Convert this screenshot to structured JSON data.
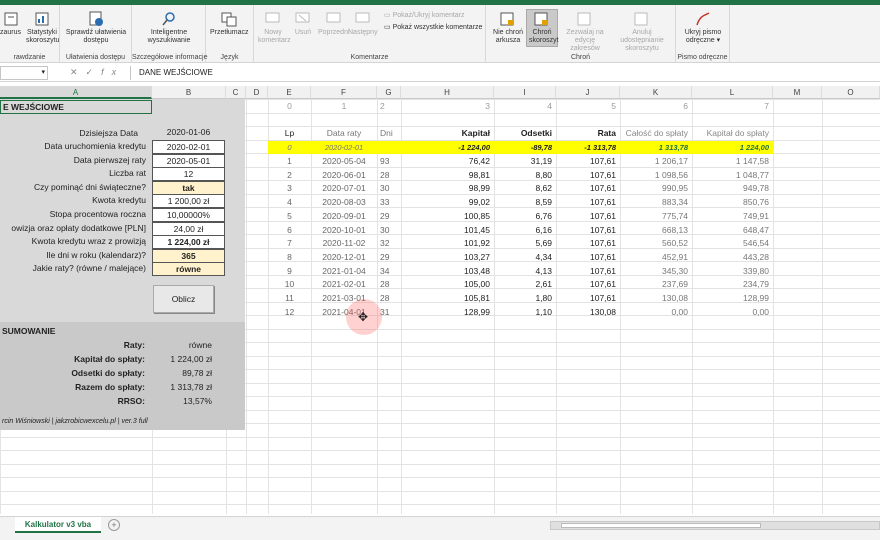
{
  "ribbon": {
    "groups": [
      {
        "label": "rawdzanie",
        "buttons": [
          "zaurus",
          "Statystyki skoroszytu"
        ]
      },
      {
        "label": "Ułatwienia dostępu",
        "buttons": [
          "Sprawdź ułatwienia dostępu"
        ]
      },
      {
        "label": "Szczegółowe informacje",
        "buttons": [
          "Inteligentne wyszukiwanie"
        ]
      },
      {
        "label": "Język",
        "buttons": [
          "Przetłumacz"
        ]
      },
      {
        "label": "Komentarze",
        "buttons": [
          "Nowy komentarz",
          "Usuń",
          "Poprzedni",
          "Następny"
        ],
        "small": [
          "Pokaż/Ukryj komentarz",
          "Pokaż wszystkie komentarze"
        ]
      },
      {
        "label": "Chroń",
        "buttons": [
          "Nie chroń arkusza",
          "Chroń skoroszyt",
          "Zezwalaj na edycję zakresów",
          "Anuluj udostępnianie skoroszytu"
        ]
      },
      {
        "label": "Pismo odręczne",
        "buttons": [
          "Ukryj pismo odręczne"
        ]
      }
    ]
  },
  "formula_bar": {
    "namebox": "",
    "content": "DANE WEJŚCIOWE",
    "icons": [
      "✕",
      "✓",
      "fx"
    ]
  },
  "columns": [
    "A",
    "B",
    "C",
    "D",
    "E",
    "F",
    "G",
    "H",
    "I",
    "J",
    "K",
    "L",
    "M",
    "O"
  ],
  "inputs": {
    "title": "E WEJŚCIOWE",
    "today_label": "Dzisiejsza Data",
    "today_value": "2020-01-06",
    "fields": [
      {
        "label": "Data uruchomienia kredytu",
        "value": "2020-02-01",
        "style": "white"
      },
      {
        "label": "Data pierwszej raty",
        "value": "2020-05-01",
        "style": "white"
      },
      {
        "label": "Liczba rat",
        "value": "12",
        "style": "white"
      },
      {
        "label": "Czy pominąć dni świąteczne?",
        "value": "tak",
        "style": "yellow"
      },
      {
        "label": "Kwota kredytu",
        "value": "1 200,00 zł",
        "style": "white"
      },
      {
        "label": "Stopa procentowa roczna",
        "value": "10,00000%",
        "style": "white"
      },
      {
        "label": "owizja oraz opłaty dodatkowe [PLN]",
        "value": "24,00 zł",
        "style": "white"
      },
      {
        "label": "Kwota kredytu wraz z prowizją",
        "value": "1 224,00 zł",
        "style": "bold"
      },
      {
        "label": "Ile dni w roku (kalendarz)?",
        "value": "365",
        "style": "yellow"
      },
      {
        "label": "Jakie raty? (równe / malejące)",
        "value": "równe",
        "style": "yellow"
      }
    ],
    "button": "Oblicz"
  },
  "summary": {
    "title": "SUMOWANIE",
    "rows": [
      {
        "label": "Raty:",
        "value": "równe"
      },
      {
        "label": "Kapitał do spłaty:",
        "value": "1 224,00 zł"
      },
      {
        "label": "Odsetki do spłaty:",
        "value": "89,78 zł"
      },
      {
        "label": "Razem do spłaty:",
        "value": "1 313,78 zł"
      },
      {
        "label": "RRSO:",
        "value": "13,57%"
      }
    ],
    "credit": "rcin Wiśniowski | jakzrobicwexcelu.pl | ver.3 full"
  },
  "table": {
    "index_row": [
      "0",
      "1",
      "2",
      "3",
      "4",
      "5",
      "6",
      "7"
    ],
    "headers": [
      "Lp",
      "Data raty",
      "Dni",
      "Kapitał",
      "Odsetki",
      "Rata",
      "Całość do spłaty",
      "Kapitał do spłaty"
    ],
    "initial_row": [
      "0",
      "2020-02-01",
      "",
      "-1 224,00",
      "-89,78",
      "-1 313,78",
      "1 313,78",
      "1 224,00"
    ],
    "rows": [
      [
        "1",
        "2020-05-04",
        "93",
        "76,42",
        "31,19",
        "107,61",
        "1 206,17",
        "1 147,58"
      ],
      [
        "2",
        "2020-06-01",
        "28",
        "98,81",
        "8,80",
        "107,61",
        "1 098,56",
        "1 048,77"
      ],
      [
        "3",
        "2020-07-01",
        "30",
        "98,99",
        "8,62",
        "107,61",
        "990,95",
        "949,78"
      ],
      [
        "4",
        "2020-08-03",
        "33",
        "99,02",
        "8,59",
        "107,61",
        "883,34",
        "850,76"
      ],
      [
        "5",
        "2020-09-01",
        "29",
        "100,85",
        "6,76",
        "107,61",
        "775,74",
        "749,91"
      ],
      [
        "6",
        "2020-10-01",
        "30",
        "101,45",
        "6,16",
        "107,61",
        "668,13",
        "648,47"
      ],
      [
        "7",
        "2020-11-02",
        "32",
        "101,92",
        "5,69",
        "107,61",
        "560,52",
        "546,54"
      ],
      [
        "8",
        "2020-12-01",
        "29",
        "103,27",
        "4,34",
        "107,61",
        "452,91",
        "443,28"
      ],
      [
        "9",
        "2021-01-04",
        "34",
        "103,48",
        "4,13",
        "107,61",
        "345,30",
        "339,80"
      ],
      [
        "10",
        "2021-02-01",
        "28",
        "105,00",
        "2,61",
        "107,61",
        "237,69",
        "234,79"
      ],
      [
        "11",
        "2021-03-01",
        "28",
        "105,81",
        "1,80",
        "107,61",
        "130,08",
        "128,99"
      ],
      [
        "12",
        "2021-04-01",
        "31",
        "128,99",
        "1,10",
        "130,08",
        "0,00",
        "0,00"
      ]
    ]
  },
  "sheet_tab": "Kalkulator v3 vba",
  "colors": {
    "accent": "#217346",
    "highlight": "#ffff00",
    "input_yellow": "#fff2cc"
  }
}
